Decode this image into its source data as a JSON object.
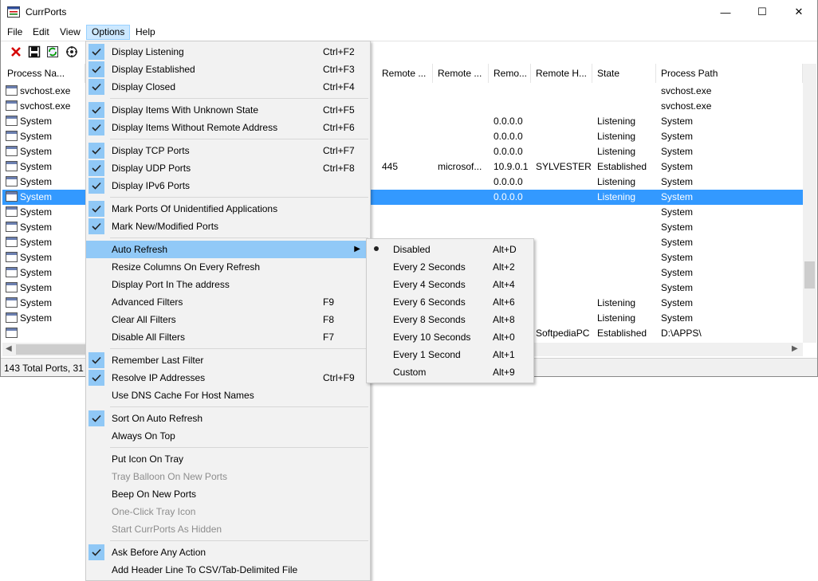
{
  "window": {
    "title": "CurrPorts",
    "minimize": "—",
    "maximize": "☐",
    "close": "✕"
  },
  "menubar": [
    {
      "label": "File"
    },
    {
      "label": "Edit"
    },
    {
      "label": "View"
    },
    {
      "label": "Options"
    },
    {
      "label": "Help"
    }
  ],
  "toolbar": [
    "close-connection-icon",
    "save-icon",
    "refresh-icon",
    "properties-icon"
  ],
  "columns": [
    {
      "label": "Process Na..."
    },
    {
      "label": "Remote ..."
    },
    {
      "label": "Remote ..."
    },
    {
      "label": "Remo..."
    },
    {
      "label": "Remote H..."
    },
    {
      "label": "State"
    },
    {
      "label": "Process Path"
    }
  ],
  "rows": [
    {
      "name": "svchost.exe",
      "rport": "",
      "rportname": "",
      "raddr": "",
      "rhost": "",
      "state": "",
      "path": "svchost.exe"
    },
    {
      "name": "svchost.exe",
      "rport": "",
      "rportname": "",
      "raddr": "",
      "rhost": "",
      "state": "",
      "path": "svchost.exe"
    },
    {
      "name": "System",
      "rport": "",
      "rportname": "",
      "raddr": "0.0.0.0",
      "rhost": "",
      "state": "Listening",
      "path": "System"
    },
    {
      "name": "System",
      "rport": "",
      "rportname": "",
      "raddr": "0.0.0.0",
      "rhost": "",
      "state": "Listening",
      "path": "System"
    },
    {
      "name": "System",
      "rport": "",
      "rportname": "",
      "raddr": "0.0.0.0",
      "rhost": "",
      "state": "Listening",
      "path": "System"
    },
    {
      "name": "System",
      "rport": "445",
      "rportname": "microsof...",
      "raddr": "10.9.0.1",
      "rhost": "SYLVESTER",
      "state": "Established",
      "path": "System"
    },
    {
      "name": "System",
      "rport": "",
      "rportname": "",
      "raddr": "0.0.0.0",
      "rhost": "",
      "state": "Listening",
      "path": "System"
    },
    {
      "name": "System",
      "rport": "",
      "rportname": "",
      "raddr": "0.0.0.0",
      "rhost": "",
      "state": "Listening",
      "path": "System"
    },
    {
      "name": "System",
      "rport": "",
      "rportname": "",
      "raddr": "",
      "rhost": "",
      "state": "",
      "path": "System"
    },
    {
      "name": "System",
      "rport": "",
      "rportname": "",
      "raddr": "",
      "rhost": "",
      "state": "",
      "path": "System"
    },
    {
      "name": "System",
      "rport": "",
      "rportname": "",
      "raddr": "",
      "rhost": "",
      "state": "",
      "path": "System"
    },
    {
      "name": "System",
      "rport": "",
      "rportname": "",
      "raddr": "",
      "rhost": "",
      "state": "",
      "path": "System"
    },
    {
      "name": "System",
      "rport": "",
      "rportname": "",
      "raddr": "",
      "rhost": "",
      "state": "",
      "path": "System"
    },
    {
      "name": "System",
      "rport": "",
      "rportname": "",
      "raddr": "",
      "rhost": "",
      "state": "",
      "path": "System"
    },
    {
      "name": "System",
      "rport": "",
      "rportname": "",
      "raddr": "",
      "rhost": "",
      "state": "Listening",
      "path": "System"
    },
    {
      "name": "System",
      "rport": "",
      "rportname": "",
      "raddr": "",
      "rhost": "",
      "state": "Listening",
      "path": "System"
    },
    {
      "name": "",
      "rport": "",
      "rportname": "",
      "raddr": "",
      "rhost": "SoftpediaPC",
      "state": "Established",
      "path": "D:\\APPS\\"
    }
  ],
  "selected_row": 7,
  "status": "143 Total Ports, 31 R",
  "options_menu": [
    {
      "label": "Display Listening",
      "shortcut": "Ctrl+F2",
      "checked": true
    },
    {
      "label": "Display Established",
      "shortcut": "Ctrl+F3",
      "checked": true
    },
    {
      "label": "Display Closed",
      "shortcut": "Ctrl+F4",
      "checked": true
    },
    {
      "sep": true
    },
    {
      "label": "Display Items With Unknown State",
      "shortcut": "Ctrl+F5",
      "checked": true
    },
    {
      "label": "Display Items Without Remote Address",
      "shortcut": "Ctrl+F6",
      "checked": true
    },
    {
      "sep": true
    },
    {
      "label": "Display TCP Ports",
      "shortcut": "Ctrl+F7",
      "checked": true
    },
    {
      "label": "Display UDP Ports",
      "shortcut": "Ctrl+F8",
      "checked": true
    },
    {
      "label": "Display IPv6 Ports",
      "shortcut": "",
      "checked": true
    },
    {
      "sep": true
    },
    {
      "label": "Mark Ports Of Unidentified  Applications",
      "shortcut": "",
      "checked": true
    },
    {
      "label": "Mark New/Modified Ports",
      "shortcut": "",
      "checked": true
    },
    {
      "sep": true
    },
    {
      "label": "Auto Refresh",
      "shortcut": "",
      "checked": false,
      "submenu": true,
      "hover": true
    },
    {
      "label": "Resize Columns On Every Refresh",
      "shortcut": "",
      "checked": false
    },
    {
      "label": "Display Port In The address",
      "shortcut": "",
      "checked": false
    },
    {
      "label": "Advanced Filters",
      "shortcut": "F9",
      "checked": false
    },
    {
      "label": "Clear All Filters",
      "shortcut": "F8",
      "checked": false
    },
    {
      "label": "Disable All Filters",
      "shortcut": "F7",
      "checked": false
    },
    {
      "sep": true
    },
    {
      "label": "Remember Last Filter",
      "shortcut": "",
      "checked": true
    },
    {
      "label": "Resolve IP Addresses",
      "shortcut": "Ctrl+F9",
      "checked": true
    },
    {
      "label": "Use DNS Cache For Host Names",
      "shortcut": "",
      "checked": false
    },
    {
      "sep": true
    },
    {
      "label": "Sort On Auto Refresh",
      "shortcut": "",
      "checked": true
    },
    {
      "label": "Always On Top",
      "shortcut": "",
      "checked": false
    },
    {
      "sep": true
    },
    {
      "label": "Put Icon On Tray",
      "shortcut": "",
      "checked": false
    },
    {
      "label": "Tray Balloon On New Ports",
      "shortcut": "",
      "checked": false,
      "disabled": true
    },
    {
      "label": "Beep On New Ports",
      "shortcut": "",
      "checked": false
    },
    {
      "label": "One-Click Tray Icon",
      "shortcut": "",
      "checked": false,
      "disabled": true
    },
    {
      "label": "Start CurrPorts As Hidden",
      "shortcut": "",
      "checked": false,
      "disabled": true
    },
    {
      "sep": true
    },
    {
      "label": "Ask Before Any Action",
      "shortcut": "",
      "checked": true
    },
    {
      "label": "Add Header Line To CSV/Tab-Delimited File",
      "shortcut": "",
      "checked": false
    }
  ],
  "auto_refresh_menu": [
    {
      "label": "Disabled",
      "shortcut": "Alt+D",
      "selected": true
    },
    {
      "label": "Every 2 Seconds",
      "shortcut": "Alt+2"
    },
    {
      "label": "Every 4 Seconds",
      "shortcut": "Alt+4"
    },
    {
      "label": "Every 6 Seconds",
      "shortcut": "Alt+6"
    },
    {
      "label": "Every 8 Seconds",
      "shortcut": "Alt+8"
    },
    {
      "label": "Every 10 Seconds",
      "shortcut": "Alt+0"
    },
    {
      "label": "Every 1 Second",
      "shortcut": "Alt+1"
    },
    {
      "label": "Custom",
      "shortcut": "Alt+9"
    }
  ],
  "colors": {
    "selection": "#3399ff",
    "menu_check_bg": "#90c8f6",
    "menu_hover": "#91c9f7",
    "menu_bg": "#f2f2f2"
  }
}
